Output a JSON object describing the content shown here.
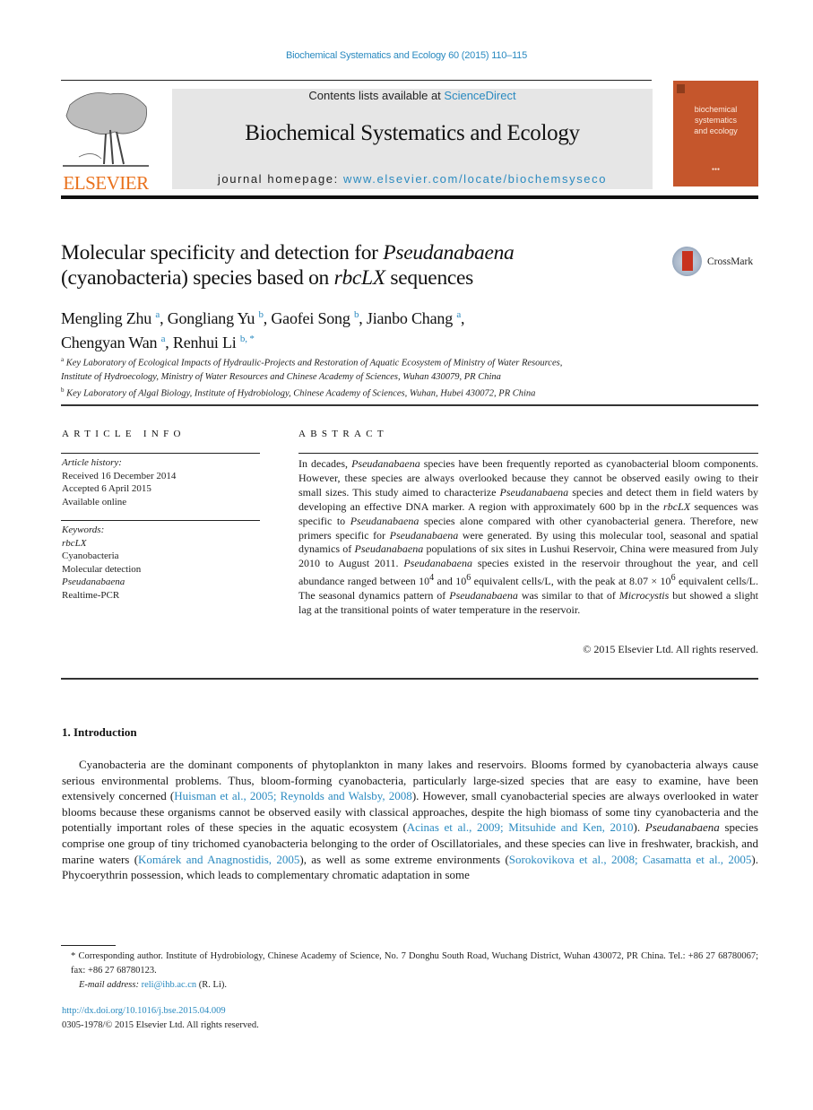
{
  "header": {
    "citation": "Biochemical Systematics and Ecology 60 (2015) 110–115",
    "publisher_logo_text": "ELSEVIER",
    "contents_prefix": "Contents lists available at ",
    "contents_link": "ScienceDirect",
    "journal_title": "Biochemical Systematics and Ecology",
    "homepage_prefix": "journal homepage: ",
    "homepage_link": "www.elsevier.com/locate/biochemsyseco",
    "cover": {
      "line1": "biochemical",
      "line2": "systematics",
      "line3": "and ecology",
      "color": "#c5562c"
    }
  },
  "article": {
    "title_part1": "Molecular specificity and detection for ",
    "title_italic1": "Pseudanabaena",
    "title_part2": "(cyanobacteria) species based on ",
    "title_italic2": "rbcLX",
    "title_part3": " sequences",
    "crossmark_label": "CrossMark",
    "authors": [
      {
        "name": "Mengling Zhu",
        "sup": "a",
        "sep": ", "
      },
      {
        "name": "Gongliang Yu",
        "sup": "b",
        "sep": ", "
      },
      {
        "name": "Gaofei Song",
        "sup": "b",
        "sep": ", "
      },
      {
        "name": "Jianbo Chang",
        "sup": "a",
        "sep": ","
      },
      {
        "name": "Chengyan Wan",
        "sup": "a",
        "sep": ", "
      },
      {
        "name": "Renhui Li",
        "sup": "b, *",
        "sep": ""
      }
    ],
    "affiliations": [
      {
        "sup": "a",
        "line1": "Key Laboratory of Ecological Impacts of Hydraulic-Projects and Restoration of Aquatic Ecosystem of Ministry of Water Resources,",
        "line2": "Institute of Hydroecology, Ministry of Water Resources and Chinese Academy of Sciences, Wuhan 430079, PR China"
      },
      {
        "sup": "b",
        "line1": "Key Laboratory of Algal Biology, Institute of Hydrobiology, Chinese Academy of Sciences, Wuhan, Hubei 430072, PR China"
      }
    ]
  },
  "article_info": {
    "heading": "ARTICLE INFO",
    "history_label": "Article history:",
    "received": "Received 16 December 2014",
    "accepted": "Accepted 6 April 2015",
    "available": "Available online",
    "keywords_label": "Keywords:",
    "keywords": [
      "rbcLX",
      "Cyanobacteria",
      "Molecular detection",
      "Pseudanabaena",
      "Realtime-PCR"
    ]
  },
  "abstract": {
    "heading": "ABSTRACT",
    "s1a": "In decades, ",
    "s1i": "Pseudanabaena",
    "s1b": " species have been frequently reported as cyanobacterial bloom components. However, these species are always overlooked because they cannot be observed easily owing to their small sizes. This study aimed to characterize ",
    "s2i": "Pseudanabaena",
    "s2b": " species and detect them in field waters by developing an effective DNA marker. A region with approximately 600 bp in the ",
    "s3i": "rbcLX",
    "s3b": " sequences was specific to ",
    "s4i": "Pseudanabaena",
    "s4b": " species alone compared with other cyanobacterial genera. Therefore, new primers specific for ",
    "s5i": "Pseudanabaena",
    "s5b": " were generated. By using this molecular tool, seasonal and spatial dynamics of ",
    "s6i": "Pseudanabaena",
    "s6b": " populations of six sites in Lushui Reservoir, China were measured from July 2010 to August 2011. ",
    "s7i": "Pseudanabaena",
    "s7b": " species existed in the reservoir throughout the year, and cell abundance ranged between 10",
    "exp1": "4",
    "s8": " and 10",
    "exp2": "6",
    "s9": " equivalent cells/L, with the peak at 8.07 × 10",
    "exp3": "6",
    "s10": " equivalent cells/L. The seasonal dynamics pattern of ",
    "s10i": "Pseudanabaena",
    "s11": " was similar to that of ",
    "s11i": "Microcystis",
    "s12": " but showed a slight lag at the transitional points of water temperature in the reservoir.",
    "copyright": "© 2015 Elsevier Ltd. All rights reserved."
  },
  "introduction": {
    "heading": "1.  Introduction",
    "p1": "Cyanobacteria are the dominant components of phytoplankton in many lakes and reservoirs. Blooms formed by cyanobacteria always cause serious environmental problems. Thus, bloom-forming cyanobacteria, particularly large-sized species that are easy to examine, have been extensively concerned (",
    "ref1": "Huisman et al., 2005; Reynolds and Walsby, 2008",
    "p2": "). However, small cyanobacterial species are always overlooked in water blooms because these organisms cannot be observed easily with classical approaches, despite the high biomass of some tiny cyanobacteria and the potentially important roles of these species in the aquatic ecosystem (",
    "ref2": "Acinas et al., 2009; Mitsuhide and Ken, 2010",
    "p3": "). ",
    "p3i": "Pseudanabaena",
    "p4": " species comprise one group of tiny trichomed cyanobacteria belonging to the order of Oscillatoriales, and these species can live in freshwater, brackish, and marine waters (",
    "ref3": "Komárek and Anagnostidis, 2005",
    "p5": "), as well as some extreme environments (",
    "ref4": "Sorokovikova et al., 2008; Casamatta et al., 2005",
    "p6": "). Phycoerythrin possession, which leads to complementary chromatic adaptation in some"
  },
  "footnotes": {
    "corresponding": "* Corresponding author. Institute of Hydrobiology, Chinese Academy of Science, No. 7 Donghu South Road, Wuchang District, Wuhan 430072, PR China. Tel.: +86 27 68780067; fax: +86 27 68780123.",
    "email_label": "E-mail address: ",
    "email": "reli@ihb.ac.cn",
    "email_suffix": " (R. Li).",
    "doi": "http://dx.doi.org/10.1016/j.bse.2015.04.009",
    "issn": "0305-1978/© 2015 Elsevier Ltd. All rights reserved."
  }
}
